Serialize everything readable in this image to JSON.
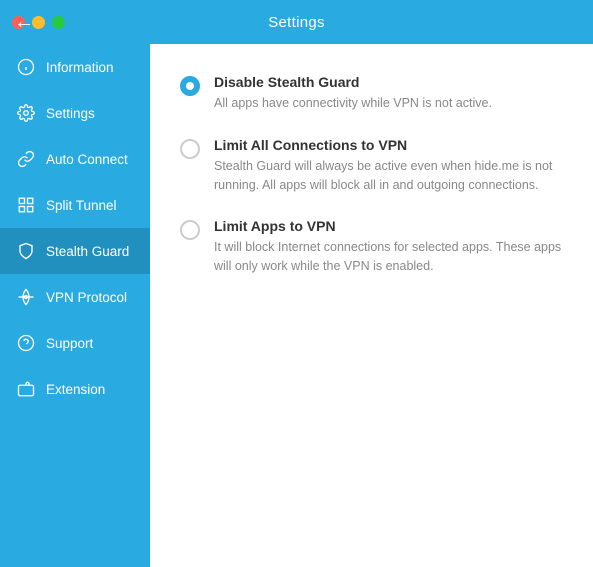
{
  "titlebar": {
    "title": "Settings",
    "back_label": "‹"
  },
  "sidebar": {
    "items": [
      {
        "id": "information",
        "label": "Information",
        "icon": "info"
      },
      {
        "id": "settings",
        "label": "Settings",
        "icon": "gear"
      },
      {
        "id": "auto-connect",
        "label": "Auto Connect",
        "icon": "link"
      },
      {
        "id": "split-tunnel",
        "label": "Split Tunnel",
        "icon": "grid"
      },
      {
        "id": "stealth-guard",
        "label": "Stealth Guard",
        "icon": "shield",
        "active": true
      },
      {
        "id": "vpn-protocol",
        "label": "VPN Protocol",
        "icon": "network"
      },
      {
        "id": "support",
        "label": "Support",
        "icon": "help"
      },
      {
        "id": "extension",
        "label": "Extension",
        "icon": "puzzle"
      }
    ]
  },
  "content": {
    "options": [
      {
        "id": "disable-stealth",
        "selected": true,
        "title": "Disable Stealth Guard",
        "description": "All apps have connectivity while VPN is not active."
      },
      {
        "id": "limit-all",
        "selected": false,
        "title": "Limit All Connections to VPN",
        "description": "Stealth Guard will always be active even when hide.me is not running. All apps will block all in and outgoing connections."
      },
      {
        "id": "limit-apps",
        "selected": false,
        "title": "Limit Apps to VPN",
        "description": "It will block Internet connections for selected apps. These apps will only work while the VPN is enabled."
      }
    ]
  }
}
